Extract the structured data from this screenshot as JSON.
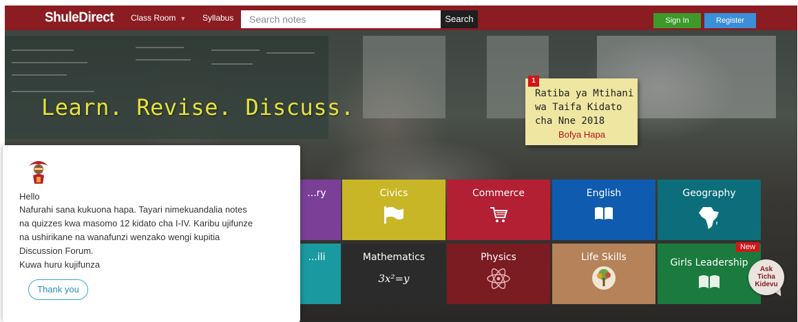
{
  "navbar": {
    "brand": "ShuleDirect",
    "classroom_label": "Class Room",
    "syllabus_label": "Syllabus",
    "search_placeholder": "Search notes",
    "search_button": "Search",
    "signin_label": "Sign In",
    "register_label": "Register",
    "background_color": "#8a1c22"
  },
  "hero": {
    "tagline": "Learn. Revise. Discuss."
  },
  "notice": {
    "badge": "1",
    "text": "Ratiba ya Mtihani wa Taifa Kidato cha Nne 2018",
    "link": "Bofya Hapa"
  },
  "subjects": [
    {
      "label": "...ry",
      "color": "#7b3f97",
      "icon": "partial-icon"
    },
    {
      "label": "Civics",
      "color": "#c9b627",
      "icon": "flag-icon"
    },
    {
      "label": "Commerce",
      "color": "#b31f33",
      "icon": "cart-icon"
    },
    {
      "label": "English",
      "color": "#0f5bb0",
      "icon": "book-icon"
    },
    {
      "label": "Geography",
      "color": "#0b6e7a",
      "icon": "africa-map-icon"
    },
    {
      "label": "...ili",
      "color": "#1a9aa0",
      "icon": "partial-icon"
    },
    {
      "label": "Mathematics",
      "color": "#2b2b2b",
      "icon": "formula-text",
      "formula": "3x²=y"
    },
    {
      "label": "Physics",
      "color": "#7a1c22",
      "icon": "atom-icon"
    },
    {
      "label": "Life Skills",
      "color": "#b5825a",
      "icon": "tree-icon"
    },
    {
      "label": "Girls Leadership",
      "color": "#1b7a3e",
      "icon": "open-book-icon",
      "badge": "New"
    }
  ],
  "ask_ticha": {
    "line1": "Ask",
    "line2": "Ticha",
    "line3": "Kidevu"
  },
  "chat": {
    "avatar_icon": "ticha-kidevu-avatar-icon",
    "hello": "Hello",
    "message_lines": [
      "Nafurahi sana kukuona hapa. Tayari nimekuandalia notes",
      "na quizzes kwa masomo 12 kidato cha I-IV. Karibu ujifunze",
      "na ushirikane na wanafunzi wenzako wengi kupitia",
      "Discussion Forum.",
      "Kuwa huru kujifunza"
    ],
    "thank_button": "Thank you"
  }
}
